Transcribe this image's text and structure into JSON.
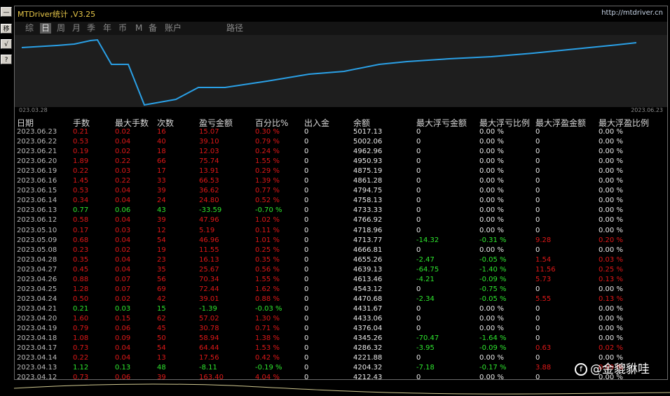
{
  "app": {
    "title": "MTDriver统计 ,V3.25",
    "url": "http://mtdriver.cn"
  },
  "left_buttons": [
    "—",
    "移",
    "√",
    "?"
  ],
  "tabs": [
    {
      "label": "综",
      "active": false
    },
    {
      "label": "日",
      "active": true
    },
    {
      "label": "周",
      "active": false
    },
    {
      "label": "月",
      "active": false
    },
    {
      "label": "季",
      "active": false
    },
    {
      "label": "年",
      "active": false
    },
    {
      "label": "币",
      "active": false
    },
    {
      "label": "M",
      "active": false
    },
    {
      "label": "备",
      "active": false
    },
    {
      "label": "账户",
      "active": false
    },
    {
      "label": "路径",
      "active": false
    }
  ],
  "equity_chart": {
    "start_label": "023.03.28",
    "end_label": "2023.06.23",
    "line_color": "#2aa0e6"
  },
  "columns": [
    "日期",
    "手数",
    "最大手数",
    "次数",
    "盈亏金额",
    "百分比%",
    "出入金",
    "余额",
    "最大浮亏金额",
    "最大浮亏比例",
    "最大浮盈金额",
    "最大浮盈比例"
  ],
  "rows": [
    [
      "2023.06.23",
      "0.21",
      "0.02",
      "16",
      "15.07",
      "0.30 %",
      "0",
      "5017.13",
      "0",
      "0.00 %",
      "0",
      "0.00 %"
    ],
    [
      "2023.06.22",
      "0.53",
      "0.04",
      "40",
      "39.10",
      "0.79 %",
      "0",
      "5002.06",
      "0",
      "0.00 %",
      "0",
      "0.00 %"
    ],
    [
      "2023.06.21",
      "0.19",
      "0.02",
      "18",
      "12.03",
      "0.24 %",
      "0",
      "4962.96",
      "0",
      "0.00 %",
      "0",
      "0.00 %"
    ],
    [
      "2023.06.20",
      "1.89",
      "0.22",
      "66",
      "75.74",
      "1.55 %",
      "0",
      "4950.93",
      "0",
      "0.00 %",
      "0",
      "0.00 %"
    ],
    [
      "2023.06.19",
      "0.22",
      "0.03",
      "17",
      "13.91",
      "0.29 %",
      "0",
      "4875.19",
      "0",
      "0.00 %",
      "0",
      "0.00 %"
    ],
    [
      "2023.06.16",
      "1.45",
      "0.22",
      "33",
      "66.53",
      "1.39 %",
      "0",
      "4861.28",
      "0",
      "0.00 %",
      "0",
      "0.00 %"
    ],
    [
      "2023.06.15",
      "0.53",
      "0.04",
      "39",
      "36.62",
      "0.77 %",
      "0",
      "4794.75",
      "0",
      "0.00 %",
      "0",
      "0.00 %"
    ],
    [
      "2023.06.14",
      "0.34",
      "0.04",
      "24",
      "24.80",
      "0.52 %",
      "0",
      "4758.13",
      "0",
      "0.00 %",
      "0",
      "0.00 %"
    ],
    [
      "2023.06.13",
      "0.77",
      "0.06",
      "43",
      "-33.59",
      "-0.70 %",
      "0",
      "4733.33",
      "0",
      "0.00 %",
      "0",
      "0.00 %"
    ],
    [
      "2023.06.12",
      "0.58",
      "0.04",
      "39",
      "47.96",
      "1.02 %",
      "0",
      "4766.92",
      "0",
      "0.00 %",
      "0",
      "0.00 %"
    ],
    [
      "2023.05.10",
      "0.17",
      "0.03",
      "12",
      "5.19",
      "0.11 %",
      "0",
      "4718.96",
      "0",
      "0.00 %",
      "0",
      "0.00 %"
    ],
    [
      "2023.05.09",
      "0.68",
      "0.04",
      "54",
      "46.96",
      "1.01 %",
      "0",
      "4713.77",
      "-14.32",
      "-0.31 %",
      "9.28",
      "0.20 %"
    ],
    [
      "2023.05.08",
      "0.23",
      "0.02",
      "19",
      "11.55",
      "0.25 %",
      "0",
      "4666.81",
      "0",
      "0.00 %",
      "0",
      "0.00 %"
    ],
    [
      "2023.04.28",
      "0.35",
      "0.04",
      "23",
      "16.13",
      "0.35 %",
      "0",
      "4655.26",
      "-2.47",
      "-0.05 %",
      "1.54",
      "0.03 %"
    ],
    [
      "2023.04.27",
      "0.45",
      "0.04",
      "35",
      "25.67",
      "0.56 %",
      "0",
      "4639.13",
      "-64.75",
      "-1.40 %",
      "11.56",
      "0.25 %"
    ],
    [
      "2023.04.26",
      "0.88",
      "0.07",
      "56",
      "70.34",
      "1.55 %",
      "0",
      "4613.46",
      "-4.21",
      "-0.09 %",
      "5.73",
      "0.13 %"
    ],
    [
      "2023.04.25",
      "1.28",
      "0.07",
      "69",
      "72.44",
      "1.62 %",
      "0",
      "4543.12",
      "0",
      "-0.75 %",
      "0",
      "0.00 %"
    ],
    [
      "2023.04.24",
      "0.50",
      "0.02",
      "42",
      "39.01",
      "0.88 %",
      "0",
      "4470.68",
      "-2.34",
      "-0.05 %",
      "5.55",
      "0.13 %"
    ],
    [
      "2023.04.21",
      "0.21",
      "0.03",
      "15",
      "-1.39",
      "-0.03 %",
      "0",
      "4431.67",
      "0",
      "0.00 %",
      "0",
      "0.00 %"
    ],
    [
      "2023.04.20",
      "1.60",
      "0.15",
      "62",
      "57.02",
      "1.30 %",
      "0",
      "4433.06",
      "0",
      "0.00 %",
      "0",
      "0.00 %"
    ],
    [
      "2023.04.19",
      "0.79",
      "0.06",
      "45",
      "30.78",
      "0.71 %",
      "0",
      "4376.04",
      "0",
      "0.00 %",
      "0",
      "0.00 %"
    ],
    [
      "2023.04.18",
      "1.08",
      "0.09",
      "50",
      "58.94",
      "1.38 %",
      "0",
      "4345.26",
      "-70.47",
      "-1.64 %",
      "0",
      "0.00 %"
    ],
    [
      "2023.04.17",
      "0.73",
      "0.04",
      "54",
      "64.44",
      "1.53 %",
      "0",
      "4286.32",
      "-3.95",
      "-0.09 %",
      "0.63",
      "0.02 %"
    ],
    [
      "2023.04.14",
      "0.22",
      "0.04",
      "13",
      "17.56",
      "0.42 %",
      "0",
      "4221.88",
      "0",
      "0.00 %",
      "0",
      "0.00 %"
    ],
    [
      "2023.04.13",
      "1.12",
      "0.13",
      "48",
      "-8.11",
      "-0.19 %",
      "0",
      "4204.32",
      "-7.18",
      "-0.17 %",
      "3.88",
      "0.09 %"
    ],
    [
      "2023.04.12",
      "0.73",
      "0.06",
      "39",
      "163.40",
      "4.04 %",
      "0",
      "4212.43",
      "0",
      "0.00 %",
      "0",
      "0.00 %"
    ]
  ],
  "watermark": {
    "icon": "f-logo-icon",
    "text": "@金貔貅哇"
  },
  "colors": {
    "profit": "#e01818",
    "loss": "#2ee62e",
    "title": "#e8c84a",
    "equity_line": "#2aa0e6"
  }
}
